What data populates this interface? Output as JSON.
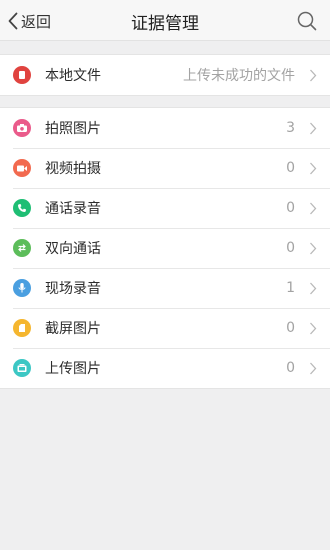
{
  "header": {
    "back_label": "返回",
    "title": "证据管理"
  },
  "local_section": {
    "label": "本地文件",
    "value": "上传未成功的文件",
    "icon": "local-file-icon",
    "color": "#e0433f"
  },
  "evidence_items": [
    {
      "label": "拍照图片",
      "count": "3",
      "icon": "camera-icon",
      "color": "#ea5b8b"
    },
    {
      "label": "视频拍摄",
      "count": "0",
      "icon": "video-icon",
      "color": "#f26a4f"
    },
    {
      "label": "通话录音",
      "count": "0",
      "icon": "phone-icon",
      "color": "#1fbe74"
    },
    {
      "label": "双向通话",
      "count": "0",
      "icon": "two-way-call-icon",
      "color": "#5cbd5a"
    },
    {
      "label": "现场录音",
      "count": "1",
      "icon": "microphone-icon",
      "color": "#4a9fe0"
    },
    {
      "label": "截屏图片",
      "count": "0",
      "icon": "screenshot-icon",
      "color": "#f5b62f"
    },
    {
      "label": "上传图片",
      "count": "0",
      "icon": "upload-image-icon",
      "color": "#3cc7c4"
    }
  ]
}
